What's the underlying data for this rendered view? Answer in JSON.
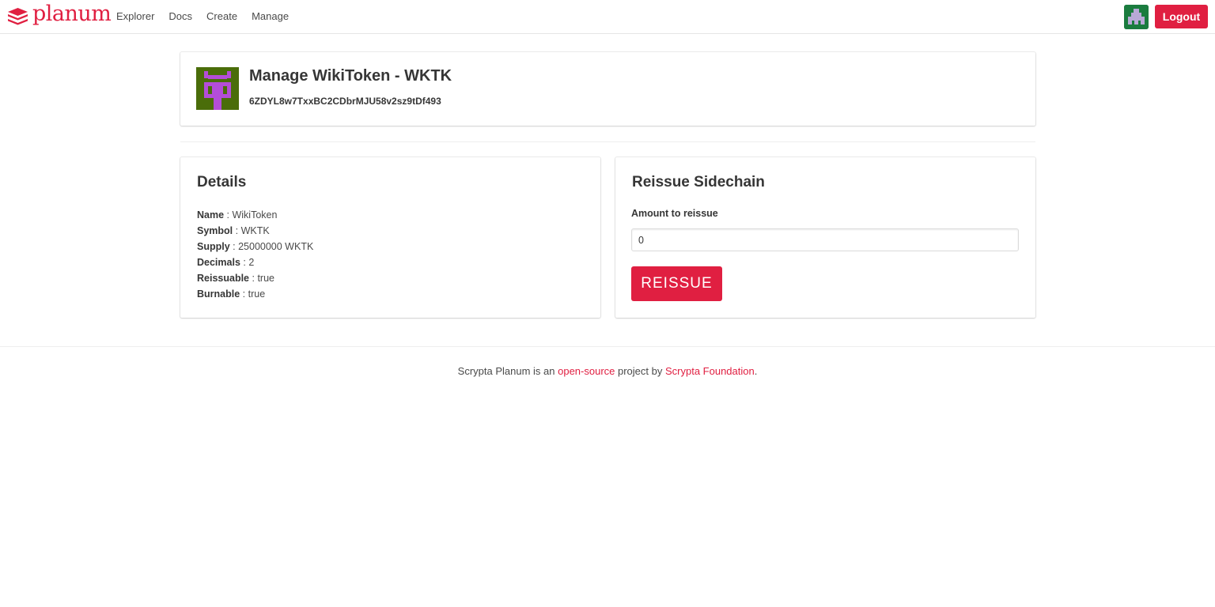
{
  "nav": {
    "brand_name": "planum",
    "logo_icon": "planum-logo-icon",
    "links": [
      "Explorer",
      "Docs",
      "Create",
      "Manage"
    ],
    "avatar_icon": "user-identicon",
    "logout_label": "Logout"
  },
  "header": {
    "title": "Manage WikiToken - WKTK",
    "address": "6ZDYL8w7TxxBC2CDbrMJU58v2sz9tDf493",
    "token_icon": "token-identicon"
  },
  "details": {
    "title": "Details",
    "rows": [
      {
        "label": "Name",
        "value": "WikiToken"
      },
      {
        "label": "Symbol",
        "value": "WKTK"
      },
      {
        "label": "Supply",
        "value": "25000000 WKTK"
      },
      {
        "label": "Decimals",
        "value": "2"
      },
      {
        "label": "Reissuable",
        "value": "true"
      },
      {
        "label": "Burnable",
        "value": "true"
      }
    ]
  },
  "reissue": {
    "title": "Reissue Sidechain",
    "amount_label": "Amount to reissue",
    "amount_value": "0",
    "button_label": "REISSUE"
  },
  "footer": {
    "prefix": "Scrypta Planum is an ",
    "link1": "open-source",
    "middle": " project by ",
    "link2": "Scrypta Foundation",
    "suffix": "."
  },
  "colors": {
    "accent": "#e01f41",
    "token_icon_bg": "#4a6d0a",
    "token_icon_fg": "#b44dd9",
    "avatar_bg": "#1b7c3f"
  }
}
